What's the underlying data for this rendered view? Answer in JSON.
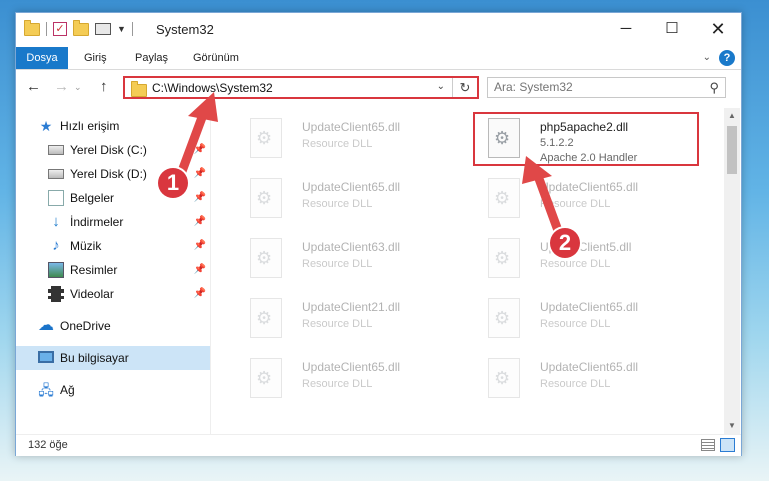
{
  "window": {
    "title": "System32",
    "minimize": "─",
    "maximize": "☐",
    "close": "✕"
  },
  "ribbon": {
    "tabs": [
      "Dosya",
      "Giriş",
      "Paylaş",
      "Görünüm"
    ]
  },
  "address": {
    "path": "C:\\Windows\\System32",
    "refresh_glyph": "↻"
  },
  "search": {
    "placeholder": "Ara: System32"
  },
  "sidebar": {
    "items": [
      {
        "label": "Hızlı erişim",
        "icon": "star-icon"
      },
      {
        "label": "Yerel Disk (C:)",
        "icon": "drive-icon",
        "pinned": true
      },
      {
        "label": "Yerel Disk (D:)",
        "icon": "drive-icon",
        "pinned": true
      },
      {
        "label": "Belgeler",
        "icon": "documents-icon",
        "pinned": true
      },
      {
        "label": "İndirmeler",
        "icon": "downloads-icon",
        "pinned": true
      },
      {
        "label": "Müzik",
        "icon": "music-icon",
        "pinned": true
      },
      {
        "label": "Resimler",
        "icon": "pictures-icon",
        "pinned": true
      },
      {
        "label": "Videolar",
        "icon": "videos-icon",
        "pinned": true
      },
      {
        "label": "OneDrive",
        "icon": "onedrive-icon"
      },
      {
        "label": "Bu bilgisayar",
        "icon": "this-pc-icon",
        "selected": true
      },
      {
        "label": "Ağ",
        "icon": "network-icon"
      }
    ]
  },
  "files": {
    "left": [
      {
        "name": "UpdateClient65.dll",
        "type": "Resource DLL"
      },
      {
        "name": "UpdateClient65.dll",
        "type": "Resource DLL"
      },
      {
        "name": "UpdateClient63.dll",
        "type": "Resource DLL"
      },
      {
        "name": "UpdateClient21.dll",
        "type": "Resource DLL"
      },
      {
        "name": "UpdateClient65.dll",
        "type": "Resource DLL"
      }
    ],
    "right": [
      {
        "name": "php5apache2.dll",
        "version": "5.1.2.2",
        "type": "Apache 2.0 Handler"
      },
      {
        "name": "UpdateClient65.dll",
        "type": "Resource DLL"
      },
      {
        "name": "UpdateClient5.dll",
        "type": "Resource DLL"
      },
      {
        "name": "UpdateClient65.dll",
        "type": "Resource DLL"
      },
      {
        "name": "UpdateClient65.dll",
        "type": "Resource DLL"
      }
    ]
  },
  "status": {
    "count": "132 öğe"
  },
  "annotations": {
    "step1": "1",
    "step2": "2",
    "color": "#d9363e"
  }
}
